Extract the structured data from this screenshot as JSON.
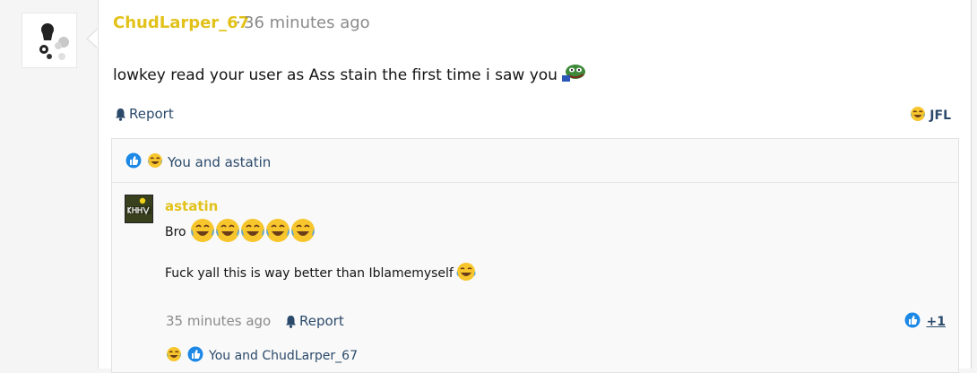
{
  "post": {
    "username": "ChudLarper_67",
    "separator": "·",
    "time": "36 minutes ago",
    "message": "lowkey read your user as Ass stain the first time i saw you",
    "report_label": "Report",
    "reaction_label": "JFL",
    "reactions_summary": "You and astatin"
  },
  "reply": {
    "username": "astatin",
    "line1": "Bro",
    "line2": "Fuck yall this is way better than Iblamemyself",
    "time": "35 minutes ago",
    "report_label": "Report",
    "like_count": "+1",
    "reactions_summary": "You and ChudLarper_67"
  },
  "icons": {
    "like": "like-icon",
    "laugh": "laughing-crying-icon",
    "pepe": "pepe-frog-icon",
    "bell": "bell-icon"
  },
  "colors": {
    "username": "#e2c21a",
    "link": "#2b4a6b",
    "meta": "#8a8a8a",
    "like_blue": "#1e88e5"
  }
}
